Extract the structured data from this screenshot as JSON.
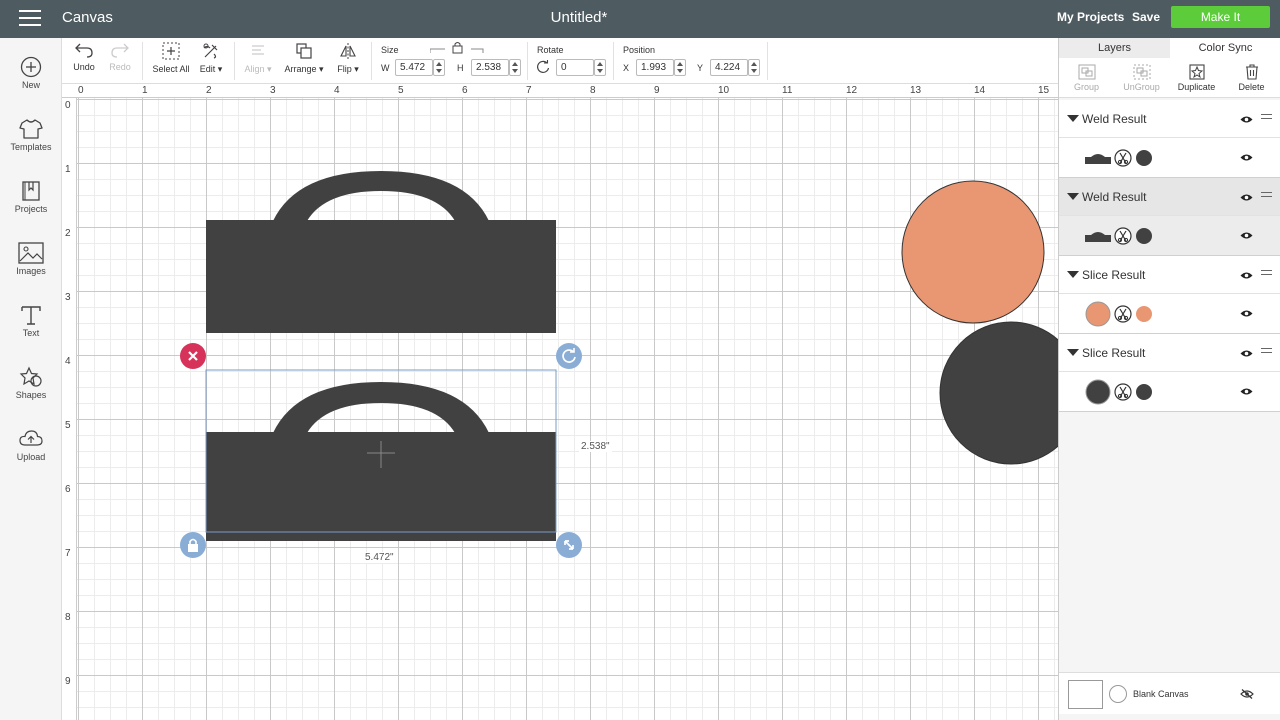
{
  "topbar": {
    "app_name": "Canvas",
    "doc_title": "Untitled*",
    "my_projects": "My Projects",
    "save": "Save",
    "make_it": "Make It",
    "accent_color": "#5ccc3a"
  },
  "sidebar": {
    "items": [
      {
        "label": "New",
        "icon": "plus-circle-icon"
      },
      {
        "label": "Templates",
        "icon": "tshirt-icon"
      },
      {
        "label": "Projects",
        "icon": "projects-icon"
      },
      {
        "label": "Images",
        "icon": "image-icon"
      },
      {
        "label": "Text",
        "icon": "text-icon"
      },
      {
        "label": "Shapes",
        "icon": "shapes-icon"
      },
      {
        "label": "Upload",
        "icon": "upload-icon"
      }
    ]
  },
  "toolbar": {
    "undo": "Undo",
    "redo": "Redo",
    "select_all": "Select All",
    "edit": "Edit",
    "align": "Align",
    "arrange": "Arrange",
    "flip": "Flip",
    "size_label": "Size",
    "w_label": "W",
    "w_value": "5.472",
    "h_label": "H",
    "h_value": "2.538",
    "rotate_label": "Rotate",
    "rotate_value": "0",
    "position_label": "Position",
    "x_label": "X",
    "x_value": "1.993",
    "y_label": "Y",
    "y_value": "4.224"
  },
  "rulers": {
    "top": [
      "0",
      "1",
      "2",
      "3",
      "4",
      "5",
      "6",
      "7",
      "8",
      "9",
      "10",
      "11",
      "12",
      "13",
      "14",
      "15"
    ],
    "left": [
      "0",
      "1",
      "2",
      "3",
      "4",
      "5",
      "6",
      "7",
      "8",
      "9"
    ]
  },
  "canvas": {
    "width_label": "5.472\"",
    "height_label": "2.538\"",
    "shape_dark_color": "#414141",
    "shape_peach_color": "#e99672",
    "delete_handle_color": "#d6325a",
    "handle_color": "#8aadd6"
  },
  "layers_panel": {
    "tabs": [
      "Layers",
      "Color Sync"
    ],
    "actions": [
      {
        "label": "Group",
        "icon": "group-icon"
      },
      {
        "label": "UnGroup",
        "icon": "ungroup-icon"
      },
      {
        "label": "Duplicate",
        "icon": "duplicate-icon"
      },
      {
        "label": "Delete",
        "icon": "trash-icon"
      }
    ],
    "groups": [
      {
        "name": "Weld Result"
      },
      {
        "name": "Weld Result"
      },
      {
        "name": "Slice Result"
      },
      {
        "name": "Slice Result"
      }
    ],
    "blank_canvas": "Blank Canvas"
  }
}
